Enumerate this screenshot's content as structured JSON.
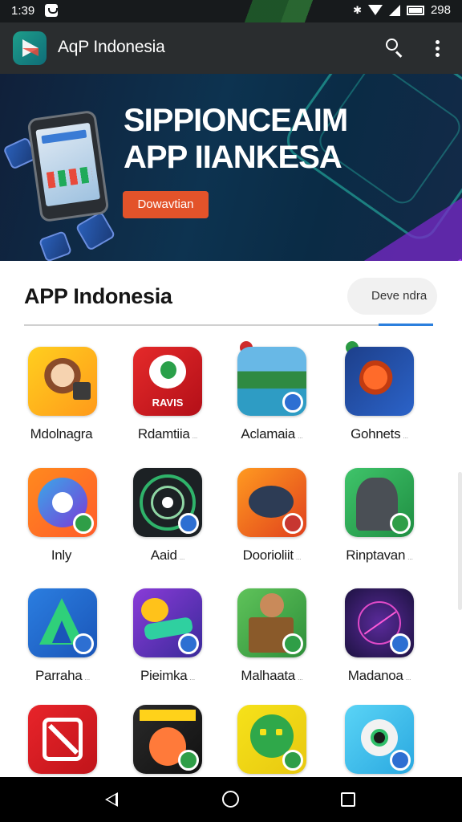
{
  "status_bar": {
    "time": "1:39",
    "battery_text": "298"
  },
  "app_bar": {
    "title": "AqP Indonesia"
  },
  "banner": {
    "heading_line1": "SIPPIONCEAIM",
    "heading_line2": "APP IIANKESA",
    "button_label": "Dowavtian"
  },
  "section": {
    "title": "APP Indonesia",
    "filter_pill": "Deve ndra"
  },
  "apps": [
    {
      "name": "Mdolnagra",
      "sub": ""
    },
    {
      "name": "Rdamtiia",
      "sub": "..."
    },
    {
      "name": "Aclamaia",
      "sub": "..."
    },
    {
      "name": "Gohnets",
      "sub": "..."
    },
    {
      "name": "Inly",
      "sub": ""
    },
    {
      "name": "Aaid",
      "sub": "..."
    },
    {
      "name": "Doorioliit",
      "sub": "..."
    },
    {
      "name": "Rinptavan",
      "sub": "..."
    },
    {
      "name": "Parraha",
      "sub": "..."
    },
    {
      "name": "Pieimka",
      "sub": "..."
    },
    {
      "name": "Malhaata",
      "sub": "..."
    },
    {
      "name": "Madanoa",
      "sub": "..."
    },
    {
      "name": "",
      "sub": ""
    },
    {
      "name": "",
      "sub": ""
    },
    {
      "name": "",
      "sub": ""
    },
    {
      "name": "",
      "sub": ""
    }
  ],
  "icon_names": {
    "app_logo": "play-store-icon",
    "search": "search-icon",
    "more": "more-vert-icon",
    "back": "back-icon",
    "home": "home-icon",
    "recents": "recents-icon"
  },
  "colors": {
    "banner_button": "#e3532a",
    "accent_tab": "#2b7fdd",
    "app_bar": "#2a2d2f"
  }
}
